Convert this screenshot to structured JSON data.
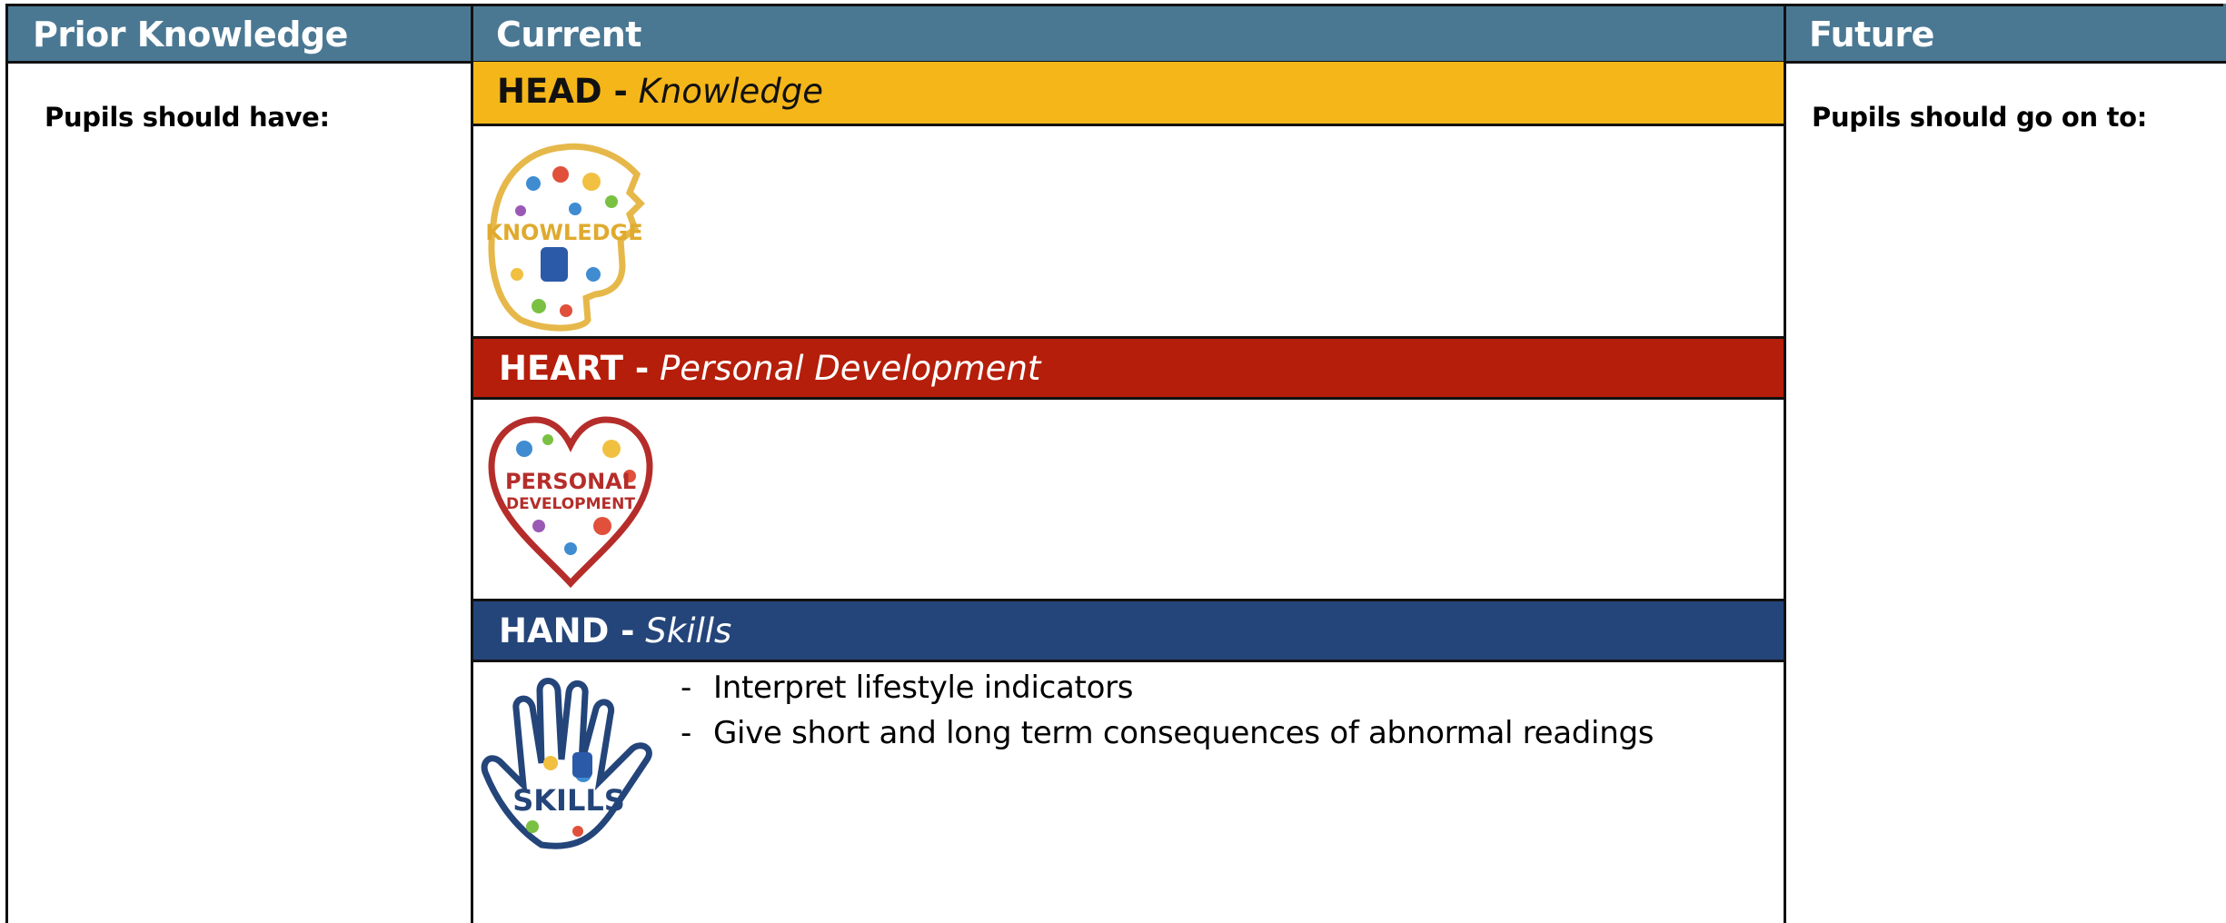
{
  "columns": {
    "prior": {
      "title": "Prior Knowledge",
      "subtitle": "Pupils should have:"
    },
    "current": {
      "title": "Current"
    },
    "future": {
      "title": "Future",
      "subtitle": "Pupils should go on to:"
    }
  },
  "sections": {
    "head": {
      "bold": "HEAD -",
      "italic": "Knowledge",
      "image_label": "KNOWLEDGE",
      "color": "#f5b61a"
    },
    "heart": {
      "bold": "HEART -",
      "italic": "Personal Development",
      "image_label_1": "PERSONAL",
      "image_label_2": "DEVELOPMENT",
      "color": "#b51e0a"
    },
    "hand": {
      "bold": "HAND -",
      "italic": "Skills",
      "image_label": "SKILLS",
      "color": "#24457a",
      "bullets": [
        "Interpret lifestyle indicators",
        "Give short and long term consequences of abnormal readings"
      ]
    }
  },
  "header_color": "#4a7893"
}
